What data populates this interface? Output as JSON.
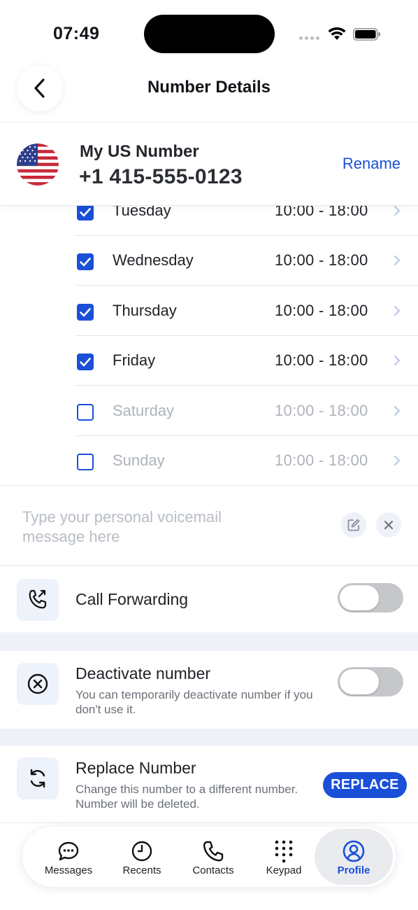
{
  "status_bar": {
    "time": "07:49"
  },
  "header": {
    "title": "Number Details"
  },
  "number": {
    "name": "My US Number",
    "value": "+1 415-555-0123",
    "rename_label": "Rename"
  },
  "schedule": {
    "days": [
      {
        "name": "Tuesday",
        "hours": "10:00 - 18:00",
        "checked": true
      },
      {
        "name": "Wednesday",
        "hours": "10:00 - 18:00",
        "checked": true
      },
      {
        "name": "Thursday",
        "hours": "10:00 - 18:00",
        "checked": true
      },
      {
        "name": "Friday",
        "hours": "10:00 - 18:00",
        "checked": true
      },
      {
        "name": "Saturday",
        "hours": "10:00 - 18:00",
        "checked": false
      },
      {
        "name": "Sunday",
        "hours": "10:00 - 18:00",
        "checked": false
      }
    ]
  },
  "voicemail": {
    "placeholder": "Type your personal voicemail message here"
  },
  "call_forwarding": {
    "title": "Call Forwarding",
    "enabled": false
  },
  "deactivate": {
    "title": "Deactivate number",
    "subtitle": "You can temporarily deactivate number if you don't use it.",
    "enabled": false
  },
  "replace": {
    "title": "Replace Number",
    "subtitle": "Change this number to a different number. Number will be deleted.",
    "button_label": "REPLACE"
  },
  "tabbar": {
    "tabs": [
      {
        "label": "Messages",
        "icon": "chat-bubble-icon"
      },
      {
        "label": "Recents",
        "icon": "clock-icon"
      },
      {
        "label": "Contacts",
        "icon": "phone-icon"
      },
      {
        "label": "Keypad",
        "icon": "keypad-icon"
      },
      {
        "label": "Profile",
        "icon": "profile-icon"
      }
    ],
    "active": "Profile"
  },
  "colors": {
    "accent": "#1a4fd8",
    "band": "#eef1f8"
  }
}
